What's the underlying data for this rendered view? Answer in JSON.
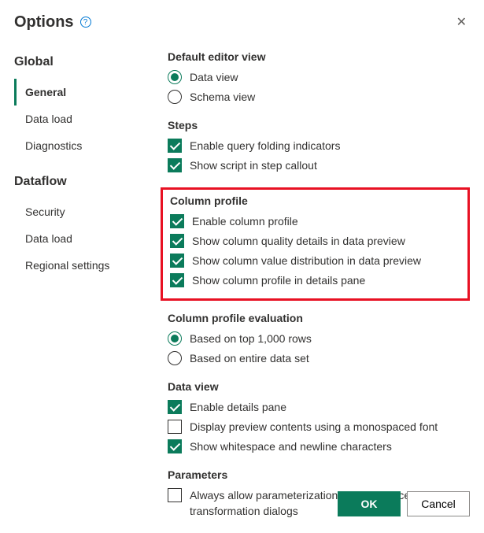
{
  "title": "Options",
  "sidebar": {
    "groups": [
      {
        "heading": "Global",
        "items": [
          {
            "label": "General",
            "selected": true
          },
          {
            "label": "Data load",
            "selected": false
          },
          {
            "label": "Diagnostics",
            "selected": false
          }
        ]
      },
      {
        "heading": "Dataflow",
        "items": [
          {
            "label": "Security",
            "selected": false
          },
          {
            "label": "Data load",
            "selected": false
          },
          {
            "label": "Regional settings",
            "selected": false
          }
        ]
      }
    ]
  },
  "sections": {
    "default_editor_view": {
      "title": "Default editor view",
      "options": [
        {
          "label": "Data view",
          "checked": true
        },
        {
          "label": "Schema view",
          "checked": false
        }
      ]
    },
    "steps": {
      "title": "Steps",
      "options": [
        {
          "label": "Enable query folding indicators",
          "checked": true
        },
        {
          "label": "Show script in step callout",
          "checked": true
        }
      ]
    },
    "column_profile": {
      "title": "Column profile",
      "options": [
        {
          "label": "Enable column profile",
          "checked": true
        },
        {
          "label": "Show column quality details in data preview",
          "checked": true
        },
        {
          "label": "Show column value distribution in data preview",
          "checked": true
        },
        {
          "label": "Show column profile in details pane",
          "checked": true
        }
      ]
    },
    "column_profile_evaluation": {
      "title": "Column profile evaluation",
      "options": [
        {
          "label": "Based on top 1,000 rows",
          "checked": true
        },
        {
          "label": "Based on entire data set",
          "checked": false
        }
      ]
    },
    "data_view": {
      "title": "Data view",
      "options": [
        {
          "label": "Enable details pane",
          "checked": true
        },
        {
          "label": "Display preview contents using a monospaced font",
          "checked": false
        },
        {
          "label": "Show whitespace and newline characters",
          "checked": true
        }
      ]
    },
    "parameters": {
      "title": "Parameters",
      "options": [
        {
          "label": "Always allow parameterization in data source and transformation dialogs",
          "checked": false
        }
      ]
    }
  },
  "buttons": {
    "ok": "OK",
    "cancel": "Cancel"
  }
}
